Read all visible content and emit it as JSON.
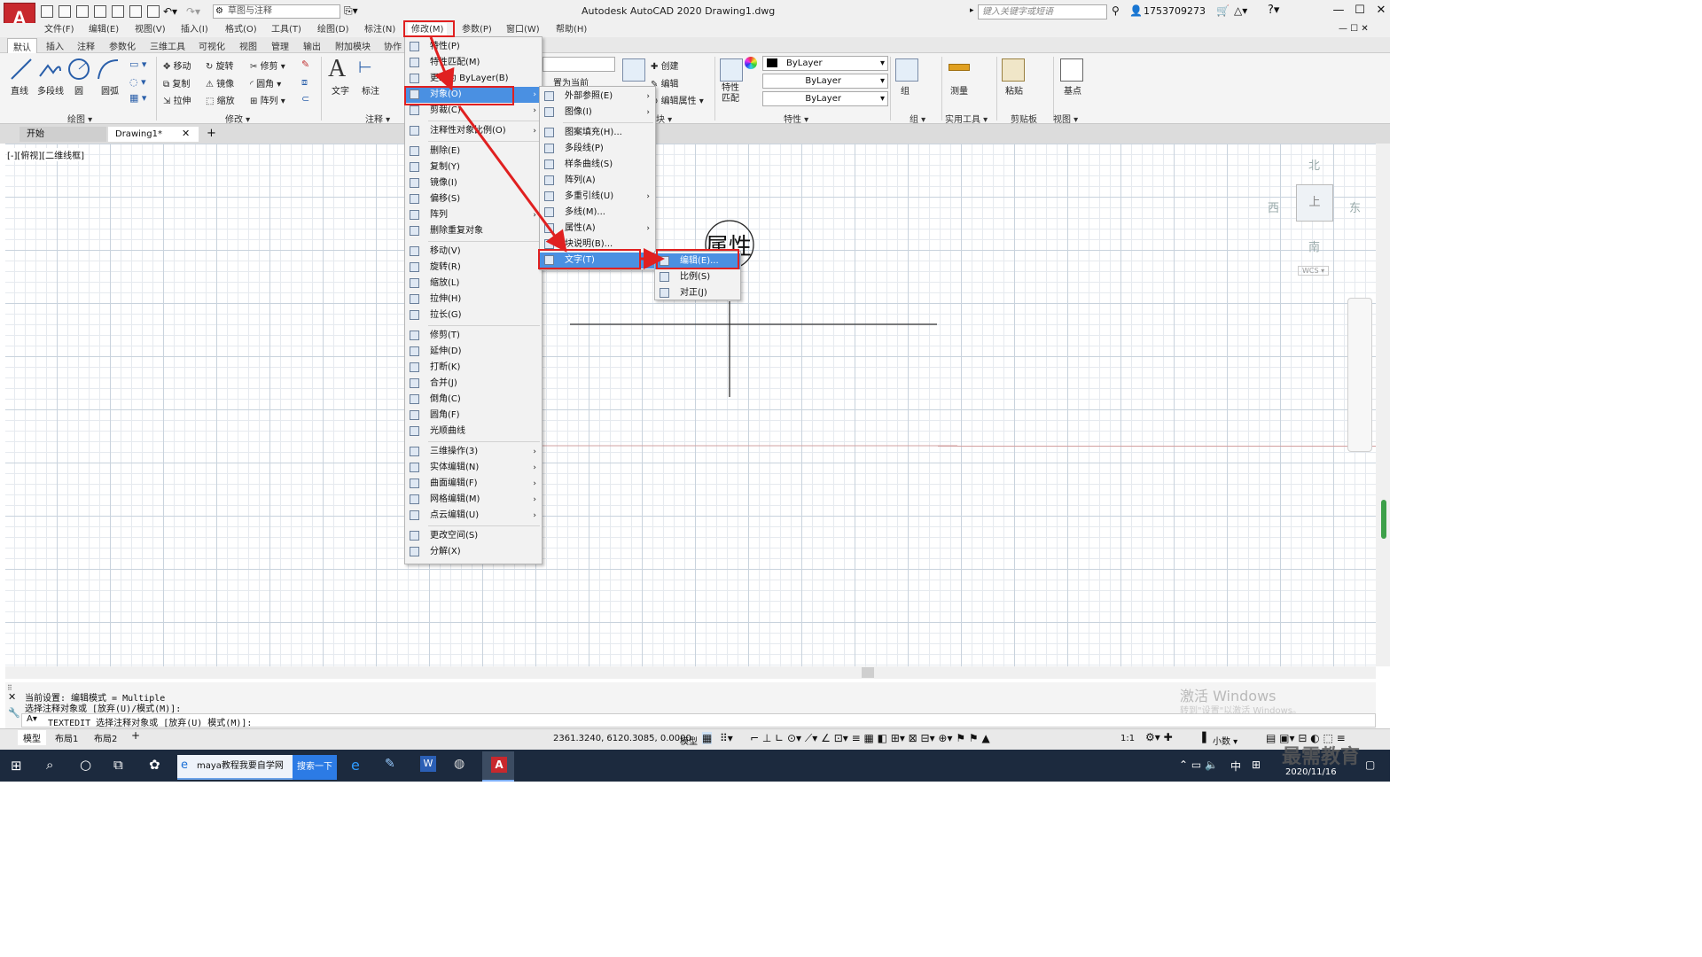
{
  "title_bar": {
    "logo": "A",
    "workspace": "草图与注释",
    "app_title": "Autodesk AutoCAD 2020    Drawing1.dwg",
    "search_placeholder": "键入关键字或短语",
    "user": "1753709273"
  },
  "menubar": [
    "文件(F)",
    "编辑(E)",
    "视图(V)",
    "插入(I)",
    "格式(O)",
    "工具(T)",
    "绘图(D)",
    "标注(N)",
    "修改(M)",
    "参数(P)",
    "窗口(W)",
    "帮助(H)"
  ],
  "ribbon_tabs": [
    "默认",
    "插入",
    "注释",
    "参数化",
    "三维工具",
    "可视化",
    "视图",
    "管理",
    "输出",
    "附加模块",
    "协作"
  ],
  "ribbon": {
    "draw_tools": [
      "直线",
      "多段线",
      "圆",
      "圆弧"
    ],
    "modify_tools": [
      "移动",
      "旋转",
      "修剪",
      "复制",
      "镜像",
      "圆角",
      "拉伸",
      "缩放",
      "阵列"
    ],
    "annotation_tools": [
      "文字",
      "标注"
    ],
    "block_tools": [
      "创建",
      "编辑",
      "编辑属性"
    ],
    "set_current": "置为当前",
    "layer_props": [
      "ByLayer",
      "ByLayer",
      "ByLayer"
    ],
    "prop_match": "特性\n匹配",
    "group": "组",
    "measure": "测量",
    "paste": "粘贴",
    "base": "基点",
    "panel_labels": [
      "绘图",
      "修改",
      "注释",
      "块",
      "特性",
      "组",
      "实用工具",
      "剪贴板",
      "视图"
    ]
  },
  "doc_tabs": [
    "开始",
    "Drawing1*"
  ],
  "viewport_label": "[-][俯视][二维线框]",
  "viewcube": {
    "north": "北",
    "south": "南",
    "east": "东",
    "west": "西",
    "face": "上",
    "wcs": "WCS"
  },
  "drawing_text": "属性",
  "modify_menu": [
    {
      "label": "特性(P)"
    },
    {
      "label": "特性匹配(M)"
    },
    {
      "label": "更改为 ByLayer(B)"
    },
    {
      "label": "对象(O)",
      "sub": true,
      "hl": true
    },
    {
      "label": "剪裁(C)",
      "sub": true
    },
    {
      "sep": true
    },
    {
      "label": "注释性对象比例(O)",
      "sub": true
    },
    {
      "sep": true
    },
    {
      "label": "删除(E)"
    },
    {
      "label": "复制(Y)"
    },
    {
      "label": "镜像(I)"
    },
    {
      "label": "偏移(S)"
    },
    {
      "label": "阵列",
      "sub": true
    },
    {
      "label": "删除重复对象"
    },
    {
      "sep": true
    },
    {
      "label": "移动(V)"
    },
    {
      "label": "旋转(R)"
    },
    {
      "label": "缩放(L)"
    },
    {
      "label": "拉伸(H)"
    },
    {
      "label": "拉长(G)"
    },
    {
      "sep": true
    },
    {
      "label": "修剪(T)"
    },
    {
      "label": "延伸(D)"
    },
    {
      "label": "打断(K)"
    },
    {
      "label": "合并(J)"
    },
    {
      "label": "倒角(C)"
    },
    {
      "label": "圆角(F)"
    },
    {
      "label": "光顺曲线"
    },
    {
      "sep": true
    },
    {
      "label": "三维操作(3)",
      "sub": true
    },
    {
      "label": "实体编辑(N)",
      "sub": true
    },
    {
      "label": "曲面编辑(F)",
      "sub": true
    },
    {
      "label": "网格编辑(M)",
      "sub": true
    },
    {
      "label": "点云编辑(U)",
      "sub": true
    },
    {
      "sep": true
    },
    {
      "label": "更改空间(S)"
    },
    {
      "label": "分解(X)"
    }
  ],
  "object_menu": [
    {
      "label": "外部参照(E)",
      "sub": true
    },
    {
      "label": "图像(I)",
      "sub": true
    },
    {
      "sep": true
    },
    {
      "label": "图案填充(H)..."
    },
    {
      "label": "多段线(P)"
    },
    {
      "label": "样条曲线(S)"
    },
    {
      "label": "阵列(A)"
    },
    {
      "label": "多重引线(U)",
      "sub": true
    },
    {
      "label": "多线(M)..."
    },
    {
      "label": "属性(A)",
      "sub": true
    },
    {
      "label": "块说明(B)..."
    },
    {
      "label": "文字(T)",
      "sub": true,
      "hl": true
    }
  ],
  "text_menu": [
    {
      "label": "编辑(E)...",
      "hl": true
    },
    {
      "label": "比例(S)"
    },
    {
      "label": "对正(J)"
    }
  ],
  "command": {
    "line1": "当前设置: 编辑模式 = Multiple",
    "line2": "选择注释对象或 [放弃(U)/模式(M)]:",
    "prompt": "TEXTEDIT 选择注释对象或 [放弃(U) 模式(M)]:"
  },
  "layout_tabs": [
    "模型",
    "布局1",
    "布局2"
  ],
  "status": {
    "coords": "2361.3240, 6120.3085, 0.0000",
    "model": "模型",
    "scale": "1:1",
    "units": "小数"
  },
  "watermark": {
    "line1": "激活 Windows",
    "line2": "转到\"设置\"以激活 Windows。"
  },
  "taskbar": {
    "ie_label": "maya教程我要自学网",
    "search_btn": "搜索一下",
    "ime": "中",
    "date": "2020/11/16",
    "brand": "最需教育"
  },
  "colors": {
    "highlight": "#4a90e2",
    "annotation_red": "#e02020",
    "autocad_red": "#c8282d"
  }
}
